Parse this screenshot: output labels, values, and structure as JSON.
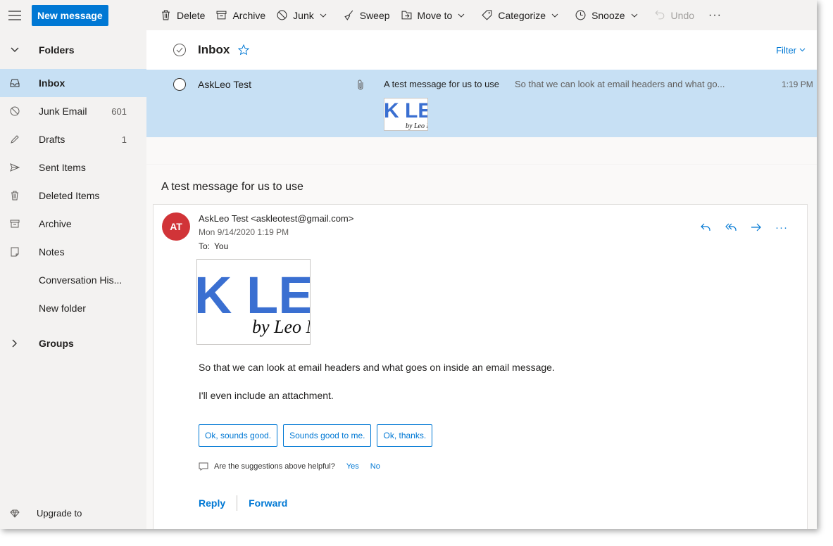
{
  "toolbar": {
    "new_message": "New message",
    "delete": "Delete",
    "archive": "Archive",
    "junk": "Junk",
    "sweep": "Sweep",
    "move_to": "Move to",
    "categorize": "Categorize",
    "snooze": "Snooze",
    "undo": "Undo",
    "more": "···"
  },
  "sidebar": {
    "folders_label": "Folders",
    "items": [
      {
        "label": "Inbox",
        "count": "",
        "icon": "inbox-icon"
      },
      {
        "label": "Junk Email",
        "count": "601",
        "icon": "junk-icon"
      },
      {
        "label": "Drafts",
        "count": "1",
        "icon": "pencil-icon"
      },
      {
        "label": "Sent Items",
        "count": "",
        "icon": "send-icon"
      },
      {
        "label": "Deleted Items",
        "count": "",
        "icon": "trash-icon"
      },
      {
        "label": "Archive",
        "count": "",
        "icon": "archive-icon"
      },
      {
        "label": "Notes",
        "count": "",
        "icon": "note-icon"
      },
      {
        "label": "Conversation His...",
        "count": "",
        "icon": ""
      },
      {
        "label": "New folder",
        "count": "",
        "icon": ""
      }
    ],
    "groups_label": "Groups",
    "upgrade_label": "Upgrade to"
  },
  "list": {
    "title": "Inbox",
    "filter": "Filter",
    "message": {
      "sender": "AskLeo Test",
      "subject": "A test message for us to use",
      "preview": "So that we can look at email headers and what go...",
      "time": "1:19 PM"
    }
  },
  "reading": {
    "subject": "A test message for us to use",
    "avatar_initials": "AT",
    "from": "AskLeo Test <askleotest@gmail.com>",
    "date": "Mon 9/14/2020 1:19 PM",
    "to_label": "To:",
    "to_value": "You",
    "logo_text": "K LE",
    "logo_sub": "by Leo N",
    "body_line1": "So that we can look at email headers and what goes on inside an email message.",
    "body_line2": "I'll even include an attachment.",
    "suggestions": [
      "Ok, sounds good.",
      "Sounds good to me.",
      "Ok, thanks."
    ],
    "feedback_q": "Are the suggestions above helpful?",
    "feedback_yes": "Yes",
    "feedback_no": "No",
    "reply": "Reply",
    "forward": "Forward"
  },
  "colors": {
    "accent": "#0078d4",
    "selected": "#c7e0f4",
    "avatar": "#d13438"
  }
}
